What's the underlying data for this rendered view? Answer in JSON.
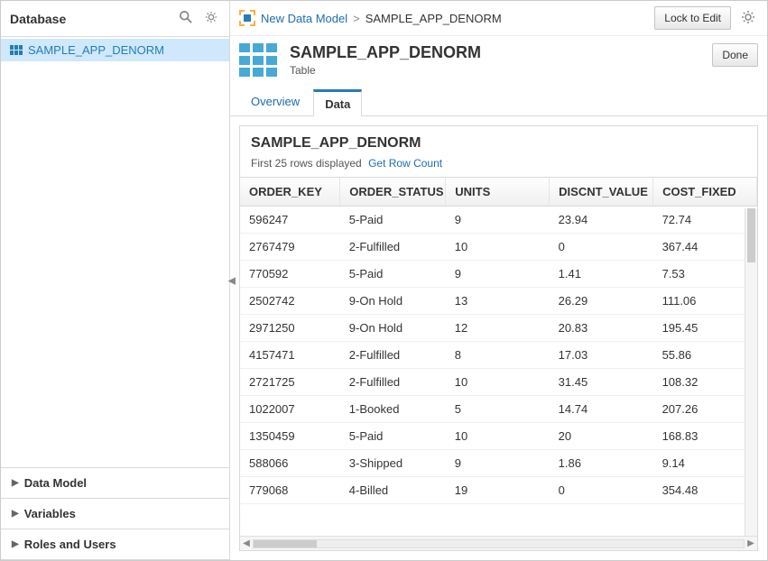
{
  "sidebar": {
    "title": "Database",
    "tree": {
      "items": [
        {
          "label": "SAMPLE_APP_DENORM"
        }
      ]
    },
    "accordion": [
      {
        "label": "Data Model"
      },
      {
        "label": "Variables"
      },
      {
        "label": "Roles and Users"
      }
    ]
  },
  "topbar": {
    "breadcrumb_link": "New Data Model",
    "breadcrumb_current": "SAMPLE_APP_DENORM",
    "lock_button": "Lock to Edit"
  },
  "header": {
    "title": "SAMPLE_APP_DENORM",
    "subtitle": "Table",
    "done_button": "Done"
  },
  "tabs": [
    {
      "label": "Overview"
    },
    {
      "label": "Data"
    }
  ],
  "panel": {
    "title": "SAMPLE_APP_DENORM",
    "rows_text": "First 25 rows displayed",
    "row_count_link": "Get Row Count",
    "columns": [
      "ORDER_KEY",
      "ORDER_STATUS",
      "UNITS",
      "DISCNT_VALUE",
      "COST_FIXED"
    ],
    "rows": [
      [
        "596247",
        "5-Paid",
        "9",
        "23.94",
        "72.74"
      ],
      [
        "2767479",
        "2-Fulfilled",
        "10",
        "0",
        "367.44"
      ],
      [
        "770592",
        "5-Paid",
        "9",
        "1.41",
        "7.53"
      ],
      [
        "2502742",
        "9-On Hold",
        "13",
        "26.29",
        "111.06"
      ],
      [
        "2971250",
        "9-On Hold",
        "12",
        "20.83",
        "195.45"
      ],
      [
        "4157471",
        "2-Fulfilled",
        "8",
        "17.03",
        "55.86"
      ],
      [
        "2721725",
        "2-Fulfilled",
        "10",
        "31.45",
        "108.32"
      ],
      [
        "1022007",
        "1-Booked",
        "5",
        "14.74",
        "207.26"
      ],
      [
        "1350459",
        "5-Paid",
        "10",
        "20",
        "168.83"
      ],
      [
        "588066",
        "3-Shipped",
        "9",
        "1.86",
        "9.14"
      ],
      [
        "779068",
        "4-Billed",
        "19",
        "0",
        "354.48"
      ]
    ]
  }
}
